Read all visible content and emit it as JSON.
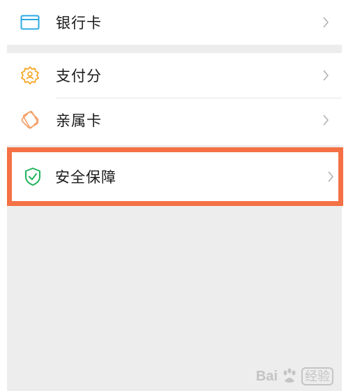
{
  "menu": {
    "bank_card": {
      "label": "银行卡",
      "icon": "bank-card-icon",
      "color": "#2fa8e0"
    },
    "payment_score": {
      "label": "支付分",
      "icon": "badge-person-icon",
      "color": "#f5a623"
    },
    "family_card": {
      "label": "亲属卡",
      "icon": "diamond-card-icon",
      "color": "#f5a06a"
    },
    "security": {
      "label": "安全保障",
      "icon": "shield-check-icon",
      "color": "#22b35c"
    }
  },
  "highlight_color": "#f47145",
  "watermark": {
    "brand": "Bai",
    "suffix": "经验"
  }
}
